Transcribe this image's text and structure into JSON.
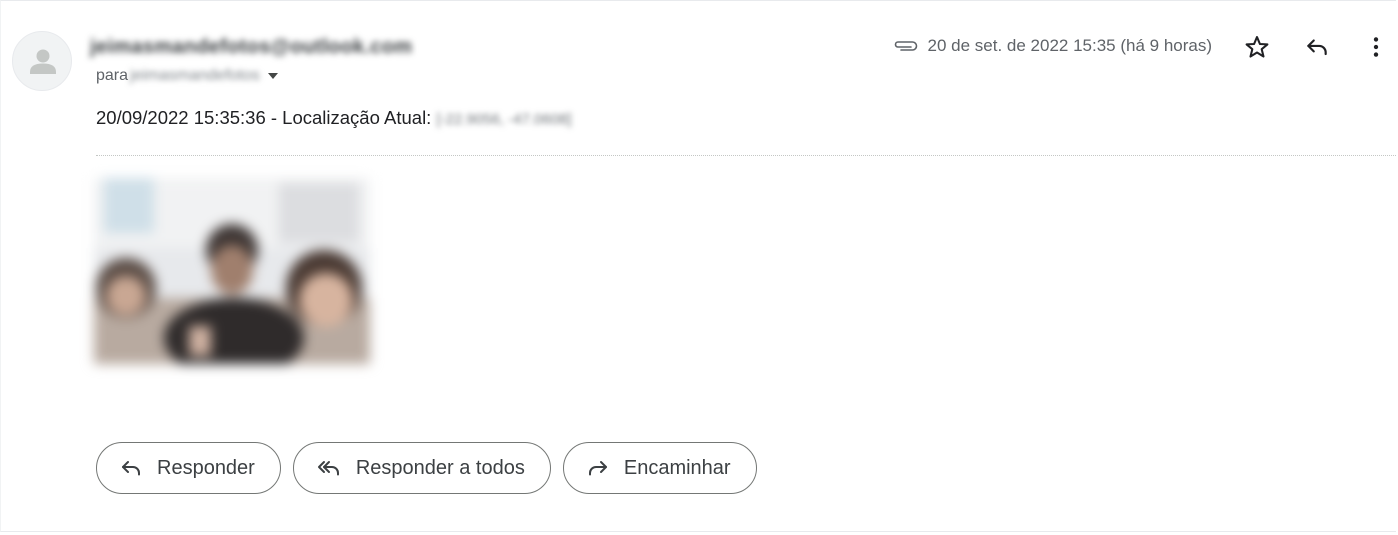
{
  "header": {
    "sender_email": "jeimasmandefotos@outlook.com",
    "to_prefix": "para",
    "to_recipient": "jeimasmandefotos",
    "date": "20 de set. de 2022 15:35 (há 9 horas)"
  },
  "message": {
    "body_prefix": "20/09/2022 15:35:36 - Localização Atual: ",
    "coordinates": "[-22.9056, -47.0608]"
  },
  "actions": {
    "reply": "Responder",
    "reply_all": "Responder a todos",
    "forward": "Encaminhar"
  },
  "icons": {
    "avatar": "person-icon",
    "attachment": "paperclip-icon",
    "star": "star-icon",
    "reply": "reply-icon",
    "more": "more-vert-icon",
    "reply_all": "reply-all-icon",
    "forward": "forward-icon"
  },
  "colors": {
    "text_primary": "#202124",
    "text_secondary": "#5f6368",
    "border": "#747775"
  }
}
